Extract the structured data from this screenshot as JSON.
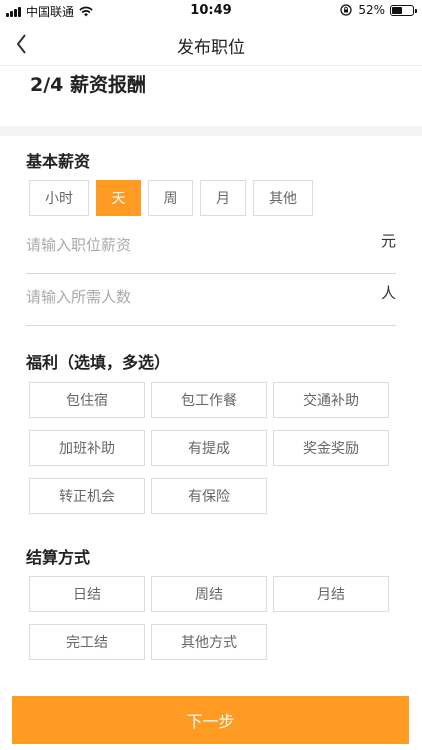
{
  "status_bar": {
    "carrier": "中国联通",
    "time": "10:49",
    "battery_text": "52%",
    "battery_level": 0.52
  },
  "nav": {
    "title": "发布职位",
    "back_icon": "chevron-left-icon"
  },
  "step_title": "2/4 薪资报酬",
  "salary": {
    "label": "基本薪资",
    "options": [
      "小时",
      "天",
      "周",
      "月",
      "其他"
    ],
    "selected": "天"
  },
  "fields": {
    "salary_placeholder": "请输入职位薪资",
    "salary_unit": "元",
    "count_placeholder": "请输入所需人数",
    "count_unit": "人"
  },
  "benefits": {
    "label": "福利（选填，多选）",
    "options": [
      "包住宿",
      "包工作餐",
      "交通补助",
      "加班补助",
      "有提成",
      "奖金奖励",
      "转正机会",
      "有保险"
    ]
  },
  "settlement": {
    "label": "结算方式",
    "options": [
      "日结",
      "周结",
      "月结",
      "完工结",
      "其他方式"
    ]
  },
  "footer": {
    "next_label": "下一步"
  },
  "colors": {
    "accent": "#ff9a22",
    "chip_border": "#dcdcdc"
  }
}
